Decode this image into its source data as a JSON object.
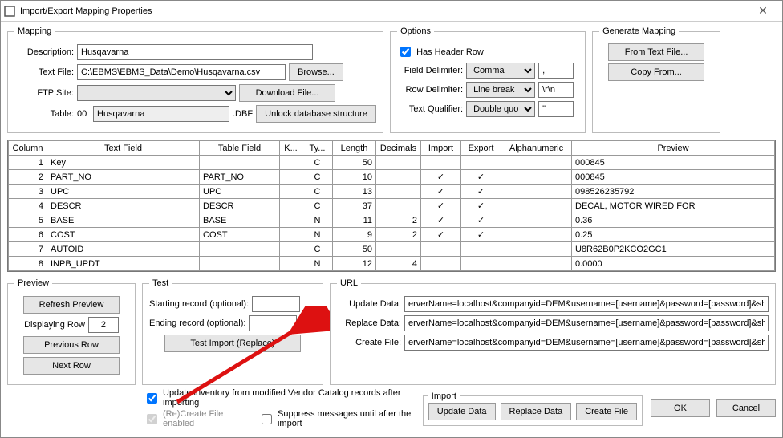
{
  "window": {
    "title": "Import/Export Mapping Properties"
  },
  "mapping": {
    "legend": "Mapping",
    "lbl_description": "Description:",
    "description": "Husqavarna",
    "lbl_textfile": "Text File:",
    "textfile": "C:\\EBMS\\EBMS_Data\\Demo\\Husqavarna.csv",
    "browse": "Browse...",
    "lbl_ftp": "FTP Site:",
    "download": "Download File...",
    "lbl_table": "Table:",
    "table_prefix": "00",
    "table_name": "Husqavarna",
    "table_suffix": ".DBF",
    "unlock": "Unlock database structure"
  },
  "options": {
    "legend": "Options",
    "has_header": "Has Header Row",
    "lbl_field_delim": "Field Delimiter:",
    "field_delim": "Comma",
    "field_delim_char": ",",
    "lbl_row_delim": "Row Delimiter:",
    "row_delim": "Line break",
    "row_delim_char": "\\r\\n",
    "lbl_text_qual": "Text Qualifier:",
    "text_qual": "Double quote",
    "text_qual_char": "\""
  },
  "generate": {
    "legend": "Generate Mapping",
    "from_text": "From Text File...",
    "copy_from": "Copy From..."
  },
  "columns": {
    "col": "Column",
    "textfield": "Text Field",
    "tablefield": "Table Field",
    "key": "K...",
    "type": "Ty...",
    "length": "Length",
    "decimals": "Decimals",
    "import": "Import",
    "export": "Export",
    "alpha": "Alphanumeric",
    "preview": "Preview"
  },
  "rows": [
    {
      "n": "1",
      "tf": "Key",
      "tbl": "",
      "key": "",
      "ty": "C",
      "len": "50",
      "dec": "",
      "imp": false,
      "exp": false,
      "alpha": "",
      "prev": "000845"
    },
    {
      "n": "2",
      "tf": "PART_NO",
      "tbl": "PART_NO",
      "key": "",
      "ty": "C",
      "len": "10",
      "dec": "",
      "imp": true,
      "exp": true,
      "alpha": "",
      "prev": "000845"
    },
    {
      "n": "3",
      "tf": "UPC",
      "tbl": "UPC",
      "key": "",
      "ty": "C",
      "len": "13",
      "dec": "",
      "imp": true,
      "exp": true,
      "alpha": "",
      "prev": "098526235792"
    },
    {
      "n": "4",
      "tf": "DESCR",
      "tbl": "DESCR",
      "key": "",
      "ty": "C",
      "len": "37",
      "dec": "",
      "imp": true,
      "exp": true,
      "alpha": "",
      "prev": "DECAL, MOTOR WIRED FOR"
    },
    {
      "n": "5",
      "tf": "BASE",
      "tbl": "BASE",
      "key": "",
      "ty": "N",
      "len": "11",
      "dec": "2",
      "imp": true,
      "exp": true,
      "alpha": "",
      "prev": "0.36"
    },
    {
      "n": "6",
      "tf": "COST",
      "tbl": "COST",
      "key": "",
      "ty": "N",
      "len": "9",
      "dec": "2",
      "imp": true,
      "exp": true,
      "alpha": "",
      "prev": "0.25"
    },
    {
      "n": "7",
      "tf": "AUTOID",
      "tbl": "",
      "key": "",
      "ty": "C",
      "len": "50",
      "dec": "",
      "imp": false,
      "exp": false,
      "alpha": "",
      "prev": "U8R62B0P2KCO2GC1"
    },
    {
      "n": "8",
      "tf": "INPB_UPDT",
      "tbl": "",
      "key": "",
      "ty": "N",
      "len": "12",
      "dec": "4",
      "imp": false,
      "exp": false,
      "alpha": "",
      "prev": "0.0000"
    }
  ],
  "preview": {
    "legend": "Preview",
    "refresh": "Refresh Preview",
    "displaying": "Displaying Row",
    "row": "2",
    "prev": "Previous Row",
    "next": "Next Row"
  },
  "test": {
    "legend": "Test",
    "start_label": "Starting record (optional):",
    "end_label": "Ending record (optional):",
    "test_btn": "Test Import (Replace)"
  },
  "url": {
    "legend": "URL",
    "update_label": "Update Data:",
    "replace_label": "Replace Data:",
    "create_label": "Create File:",
    "value": "erverName=localhost&companyid=DEM&username=[username]&password=[password]&showui=false&Connect"
  },
  "checks": {
    "update_inventory": "Update inventory from modified Vendor Catalog records after importing",
    "recreate": "(Re)Create File enabled",
    "suppress": "Suppress messages until after the import"
  },
  "import": {
    "legend": "Import",
    "update": "Update Data",
    "replace": "Replace Data",
    "create": "Create File"
  },
  "dialog": {
    "ok": "OK",
    "cancel": "Cancel"
  }
}
